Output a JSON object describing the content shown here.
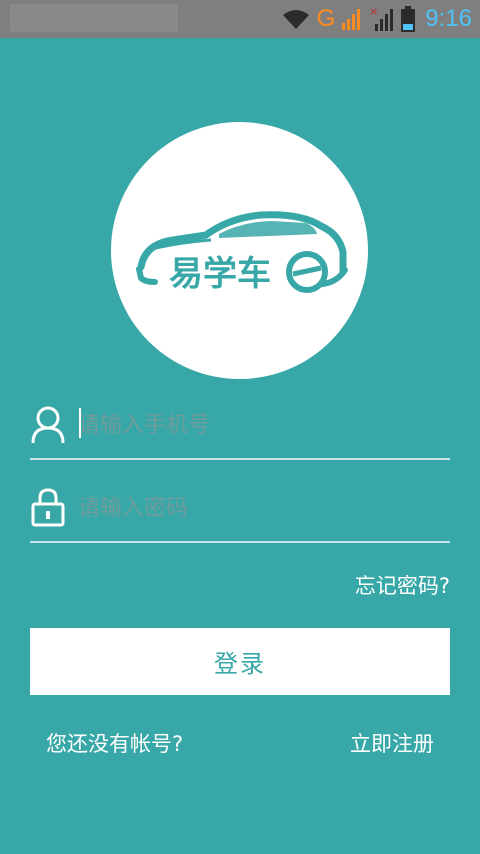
{
  "status_bar": {
    "network_label": "G",
    "time": "9:16",
    "icons": [
      "wifi-icon",
      "signal-icon",
      "no-signal-icon",
      "battery-icon"
    ]
  },
  "logo": {
    "brand_text": "易学车"
  },
  "form": {
    "phone_placeholder": "请输入手机号",
    "password_placeholder": "请输入密码",
    "forgot_label": "忘记密码?",
    "login_label": "登录"
  },
  "footer": {
    "no_account_label": "您还没有帐号?",
    "register_label": "立即注册"
  },
  "colors": {
    "background": "#38a7a7",
    "white": "#ffffff",
    "status_bar": "#7f7f7f"
  }
}
